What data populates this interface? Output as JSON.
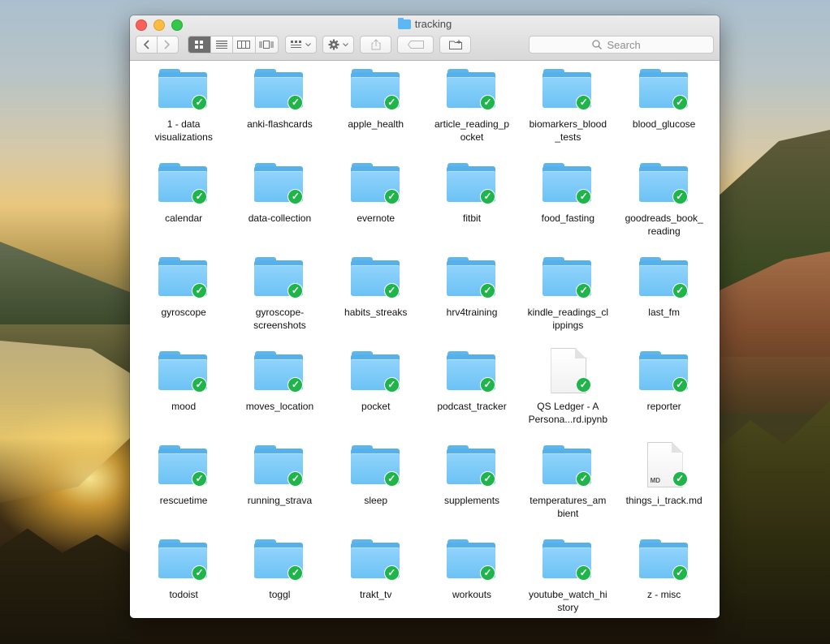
{
  "window": {
    "title": "tracking"
  },
  "toolbar": {
    "search_placeholder": "Search",
    "back_icon": "chevron-left-icon",
    "forward_icon": "chevron-right-icon"
  },
  "items": [
    {
      "label": "1 - data\nvisualizations",
      "type": "folder"
    },
    {
      "label": "anki-flashcards",
      "type": "folder"
    },
    {
      "label": "apple_health",
      "type": "folder"
    },
    {
      "label": "article_reading_p\nocket",
      "type": "folder"
    },
    {
      "label": "biomarkers_blood\n_tests",
      "type": "folder"
    },
    {
      "label": "blood_glucose",
      "type": "folder"
    },
    {
      "label": "calendar",
      "type": "folder"
    },
    {
      "label": "data-collection",
      "type": "folder"
    },
    {
      "label": "evernote",
      "type": "folder"
    },
    {
      "label": "fitbit",
      "type": "folder"
    },
    {
      "label": "food_fasting",
      "type": "folder"
    },
    {
      "label": "goodreads_book_\nreading",
      "type": "folder"
    },
    {
      "label": "gyroscope",
      "type": "folder"
    },
    {
      "label": "gyroscope-\nscreenshots",
      "type": "folder"
    },
    {
      "label": "habits_streaks",
      "type": "folder"
    },
    {
      "label": "hrv4training",
      "type": "folder"
    },
    {
      "label": "kindle_readings_cl\nippings",
      "type": "folder"
    },
    {
      "label": "last_fm",
      "type": "folder"
    },
    {
      "label": "mood",
      "type": "folder"
    },
    {
      "label": "moves_location",
      "type": "folder"
    },
    {
      "label": "pocket",
      "type": "folder"
    },
    {
      "label": "podcast_tracker",
      "type": "folder"
    },
    {
      "label": "QS Ledger - A\nPersona...rd.ipynb",
      "type": "file"
    },
    {
      "label": "reporter",
      "type": "folder"
    },
    {
      "label": "rescuetime",
      "type": "folder"
    },
    {
      "label": "running_strava",
      "type": "folder"
    },
    {
      "label": "sleep",
      "type": "folder"
    },
    {
      "label": "supplements",
      "type": "folder"
    },
    {
      "label": "temperatures_am\nbient",
      "type": "folder"
    },
    {
      "label": "things_i_track.md",
      "type": "md",
      "badge": "MD"
    },
    {
      "label": "todoist",
      "type": "folder"
    },
    {
      "label": "toggl",
      "type": "folder"
    },
    {
      "label": "trakt_tv",
      "type": "folder"
    },
    {
      "label": "workouts",
      "type": "folder"
    },
    {
      "label": "youtube_watch_hi\nstory",
      "type": "folder"
    },
    {
      "label": "z - misc",
      "type": "folder"
    }
  ],
  "colors": {
    "folder": "#6cc2f5",
    "sync_check": "#1fb54a",
    "close": "#fc605b",
    "minimize": "#fdbc40",
    "maximize": "#34c84a"
  }
}
